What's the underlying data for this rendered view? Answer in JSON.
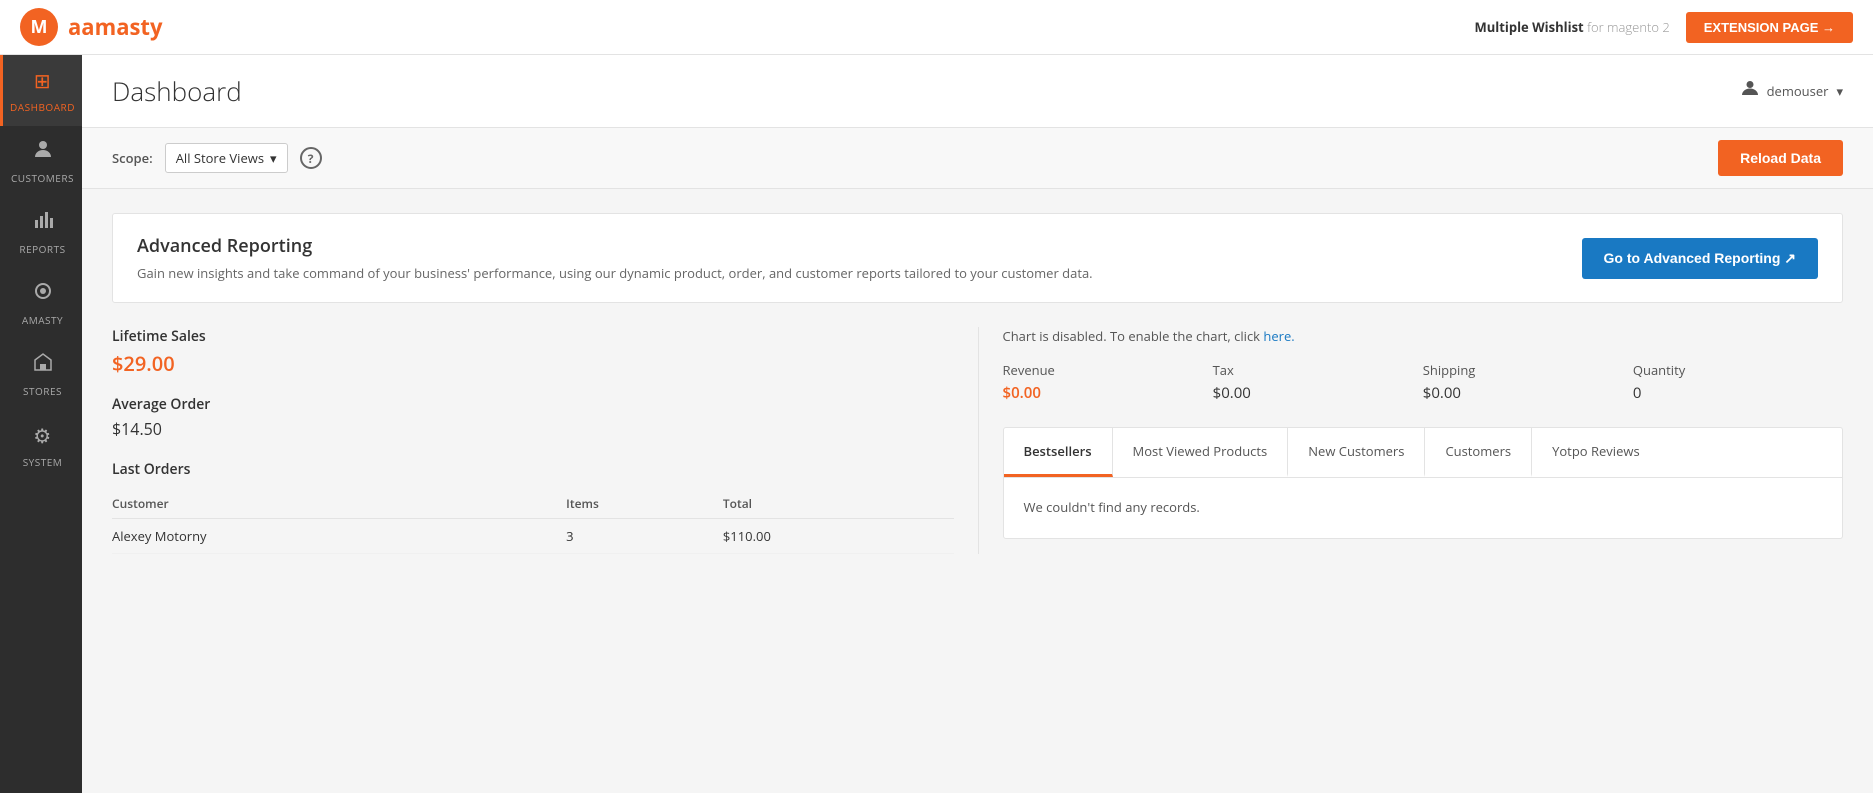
{
  "header": {
    "logo_text": "amasty",
    "logo_highlight": "a",
    "extension_label": "Multiple Wishlist",
    "extension_subtitle": "for magento 2",
    "extension_btn_label": "EXTENSION PAGE →"
  },
  "sidebar": {
    "items": [
      {
        "id": "dashboard",
        "label": "DASHBOARD",
        "icon": "⊞",
        "active": true
      },
      {
        "id": "customers",
        "label": "CUSTOMERS",
        "icon": "👤",
        "active": false
      },
      {
        "id": "reports",
        "label": "REPORTS",
        "icon": "📊",
        "active": false
      },
      {
        "id": "amasty",
        "label": "AMASTY",
        "icon": "◈",
        "active": false
      },
      {
        "id": "stores",
        "label": "STORES",
        "icon": "🏪",
        "active": false
      },
      {
        "id": "system",
        "label": "SYSTEM",
        "icon": "⚙",
        "active": false
      }
    ]
  },
  "page": {
    "title": "Dashboard",
    "user_name": "demouser",
    "user_dropdown": "▾"
  },
  "scope_bar": {
    "label": "Scope:",
    "scope_value": "All Store Views",
    "scope_dropdown": "▾",
    "help_icon": "?",
    "reload_btn": "Reload Data"
  },
  "advanced_reporting": {
    "title": "Advanced Reporting",
    "description": "Gain new insights and take command of your business' performance, using our dynamic product, order, and customer reports tailored to your customer data.",
    "btn_label": "Go to Advanced Reporting ↗"
  },
  "stats": {
    "lifetime_sales_label": "Lifetime Sales",
    "lifetime_sales_value": "$29.00",
    "avg_order_label": "Average Order",
    "avg_order_value": "$14.50",
    "last_orders_label": "Last Orders",
    "last_orders_cols": [
      "Customer",
      "Items",
      "Total"
    ],
    "last_orders_rows": [
      {
        "customer": "Alexey Motorny",
        "items": "3",
        "total": "$110.00"
      }
    ]
  },
  "chart": {
    "disabled_text": "Chart is disabled. To enable the chart, click",
    "disabled_link": "here.",
    "metrics": [
      {
        "id": "revenue",
        "label": "Revenue",
        "value": "$0.00",
        "orange": true
      },
      {
        "id": "tax",
        "label": "Tax",
        "value": "$0.00",
        "orange": false
      },
      {
        "id": "shipping",
        "label": "Shipping",
        "value": "$0.00",
        "orange": false
      },
      {
        "id": "quantity",
        "label": "Quantity",
        "value": "0",
        "orange": false
      }
    ]
  },
  "tabs": {
    "items": [
      {
        "id": "bestsellers",
        "label": "Bestsellers",
        "active": true
      },
      {
        "id": "most-viewed",
        "label": "Most Viewed Products",
        "active": false
      },
      {
        "id": "new-customers",
        "label": "New Customers",
        "active": false
      },
      {
        "id": "customers",
        "label": "Customers",
        "active": false
      },
      {
        "id": "yotpo",
        "label": "Yotpo Reviews",
        "active": false
      }
    ],
    "no_records_text": "We couldn't find any records."
  }
}
